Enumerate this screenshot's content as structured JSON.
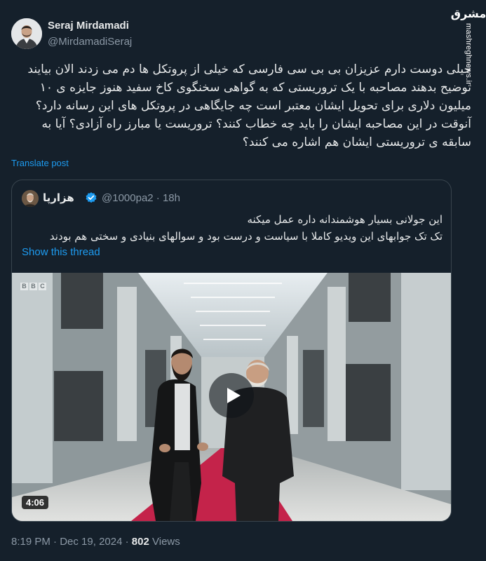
{
  "author": {
    "name": "Seraj Mirdamadi",
    "handle": "@MirdamadiSeraj"
  },
  "watermark": {
    "logo": "مشرق",
    "url": "mashreghnews.ir"
  },
  "tweet": {
    "text": "خیلی دوست دارم عزیزان بی بی سی فارسی که خیلی از پروتکل ها دم می زدند الان بیایند توضیح بدهند مصاحبه با یک تروریستی که به گواهی سخنگوی کاخ سفید هنوز جایزه ی ۱۰ میلیون دلاری برای تحویل ایشان معتبر است چه جایگاهی در پروتکل های این رسانه دارد؟ آنوقت در این مصاحبه ایشان را باید چه خطاب کنند؟ تروریست یا مبارز راه آزادی؟ آیا به سابقه ی تروریستی ایشان هم اشاره می کنند؟",
    "translate_label": "Translate post",
    "time": "8:19 PM",
    "date": "Dec 19, 2024",
    "views_count": "802",
    "views_label": "Views"
  },
  "quote": {
    "name": "هزارپا",
    "handle": "@1000pa2",
    "age": "18h",
    "line1": "این جولانی بسیار هوشمندانه داره عمل میکنه",
    "line2": "تک تک جوابهای این ویدیو کاملا با سیاست و درست بود و سوالهای بنیادی و سختی هم بودند",
    "show_thread": "Show this thread",
    "video": {
      "duration": "4:06",
      "broadcaster": [
        "B",
        "B",
        "C"
      ]
    }
  },
  "colors": {
    "background": "#15202b",
    "link": "#1d9bf0",
    "secondary_text": "#8b98a5",
    "verified": "#1d9bf0"
  }
}
